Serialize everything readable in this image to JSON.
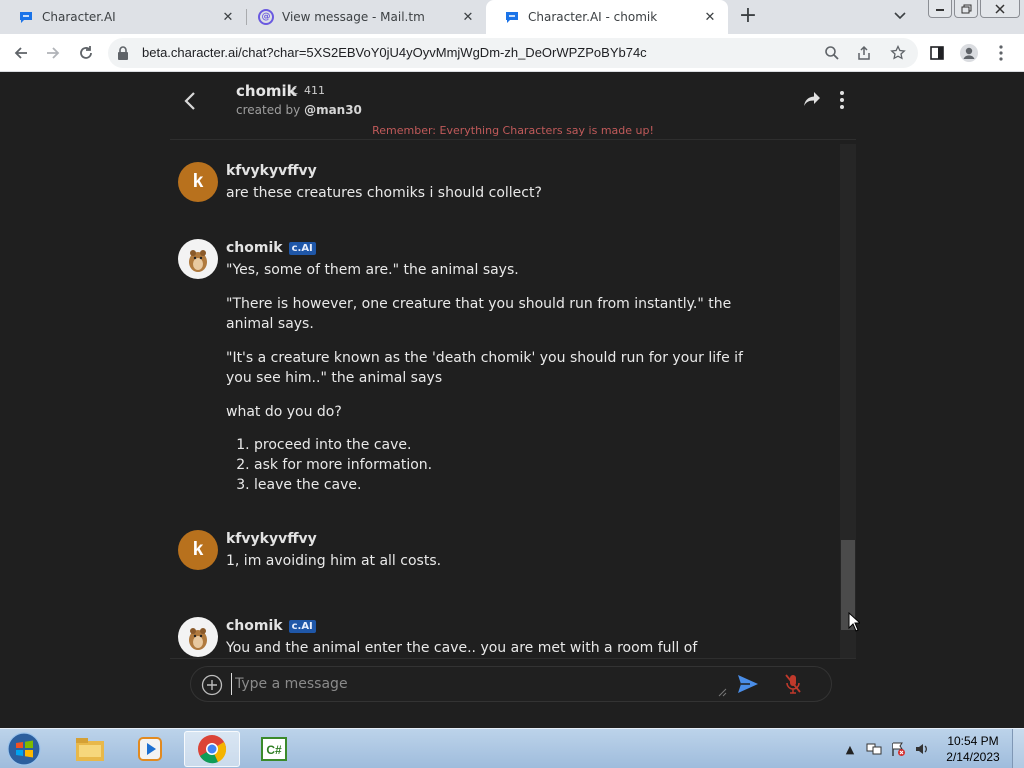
{
  "browser": {
    "tabs": [
      {
        "title": "Character.AI",
        "icon": "character-ai-icon",
        "active": false
      },
      {
        "title": "View message - Mail.tm",
        "icon": "mail-tm-icon",
        "active": false
      },
      {
        "title": "Character.AI - chomik",
        "icon": "character-ai-icon",
        "active": true
      }
    ],
    "new_tab_label": "+",
    "url": "beta.character.ai/chat?char=5XS2EBVoY0jU4yOyvMmjWgDm-zh_DeOrWPZPoBYb74c"
  },
  "chat": {
    "character_name": "chomik",
    "interaction_count": "411",
    "created_by_prefix": "created by ",
    "creator": "@man30",
    "reminder": "Remember: Everything Characters say is made up!",
    "badge": "c.AI",
    "messages": [
      {
        "author": "kfvykyvffvy",
        "avatar_letter": "k",
        "role": "user",
        "text": "are these creatures chomiks i should collect?"
      },
      {
        "author": "chomik",
        "role": "bot",
        "paragraphs": [
          "\"Yes, some of them are.\" the animal says.",
          "\"There is however, one creature that you should run from instantly.\" the animal says.",
          "\"It's a creature known as the 'death chomik' you should run for your life if you see him..\" the animal says",
          "what do you do?"
        ],
        "list": [
          "proceed into the cave.",
          "ask for more information.",
          "leave the cave."
        ]
      },
      {
        "author": "kfvykyvffvy",
        "avatar_letter": "k",
        "role": "user",
        "text": "1, im avoiding him at all costs."
      },
      {
        "author": "chomik",
        "role": "bot",
        "text": "You and the animal enter the cave.. you are met with a room full of chomiks."
      }
    ],
    "input_placeholder": "Type a message"
  },
  "taskbar": {
    "time": "10:54 PM",
    "date": "2/14/2023"
  },
  "colors": {
    "page_bg": "#1f1f1f",
    "user_avatar": "#b8711d",
    "badge": "#1f57a8",
    "reminder": "#c05a5a",
    "mic_muted": "#c0392b"
  }
}
